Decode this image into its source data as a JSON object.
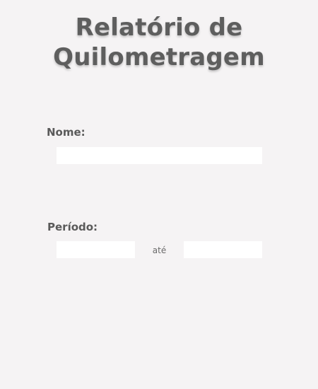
{
  "header": {
    "title_line1": "Relatório de",
    "title_line2": "Quilometragem"
  },
  "form": {
    "nome": {
      "label": "Nome:",
      "value": "",
      "placeholder": ""
    },
    "periodo": {
      "label": "Período:",
      "inicio_value": "",
      "separator": "até",
      "fim_value": ""
    }
  }
}
